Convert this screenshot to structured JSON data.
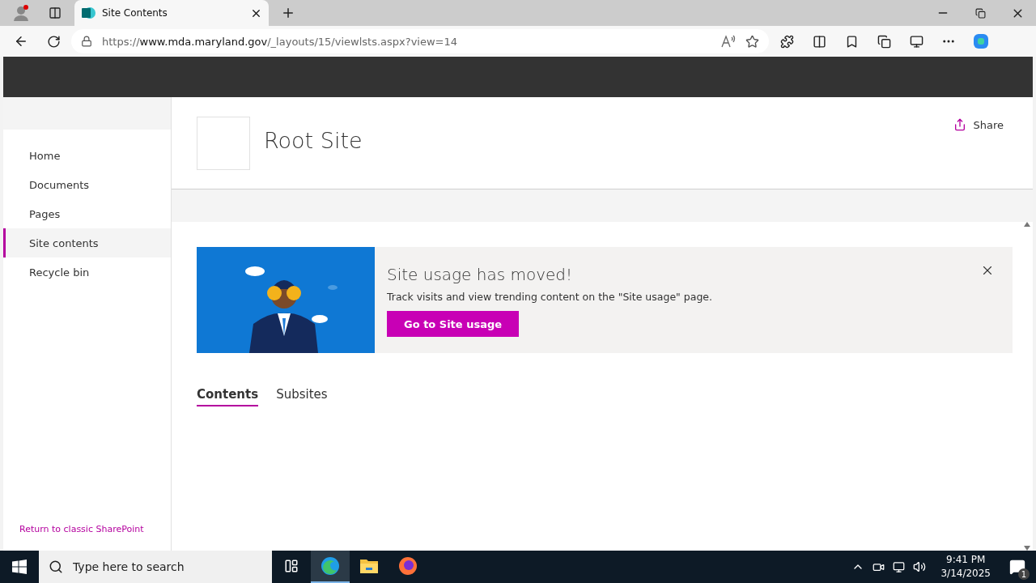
{
  "browser": {
    "tabs": [
      {
        "title": "Site Contents",
        "selected": true
      }
    ],
    "address": {
      "scheme": "https://",
      "host": "www.mda.maryland.gov",
      "path": "/_layouts/15/viewlsts.aspx?view=14"
    }
  },
  "sidebar": {
    "items": [
      {
        "label": "Home",
        "selected": false
      },
      {
        "label": "Documents",
        "selected": false
      },
      {
        "label": "Pages",
        "selected": false
      },
      {
        "label": "Site contents",
        "selected": true
      },
      {
        "label": "Recycle bin",
        "selected": false
      }
    ],
    "footer_link": "Return to classic SharePoint"
  },
  "header": {
    "site_title": "Root Site",
    "share": "Share"
  },
  "banner": {
    "title": "Site usage has moved!",
    "text": "Track visits and view trending content on the \"Site usage\" page.",
    "button": "Go to Site usage"
  },
  "pivots": [
    {
      "label": "Contents",
      "selected": true
    },
    {
      "label": "Subsites",
      "selected": false
    }
  ],
  "taskbar": {
    "search": {
      "placeholder": "Type here to search"
    },
    "apps": [
      {
        "kind": "taskview",
        "selected": false
      },
      {
        "kind": "edge",
        "selected": true
      },
      {
        "kind": "explorer",
        "selected": false
      },
      {
        "kind": "firefox",
        "selected": false
      }
    ],
    "time": "9:41 PM",
    "date": "3/14/2025",
    "notifications": "1"
  }
}
